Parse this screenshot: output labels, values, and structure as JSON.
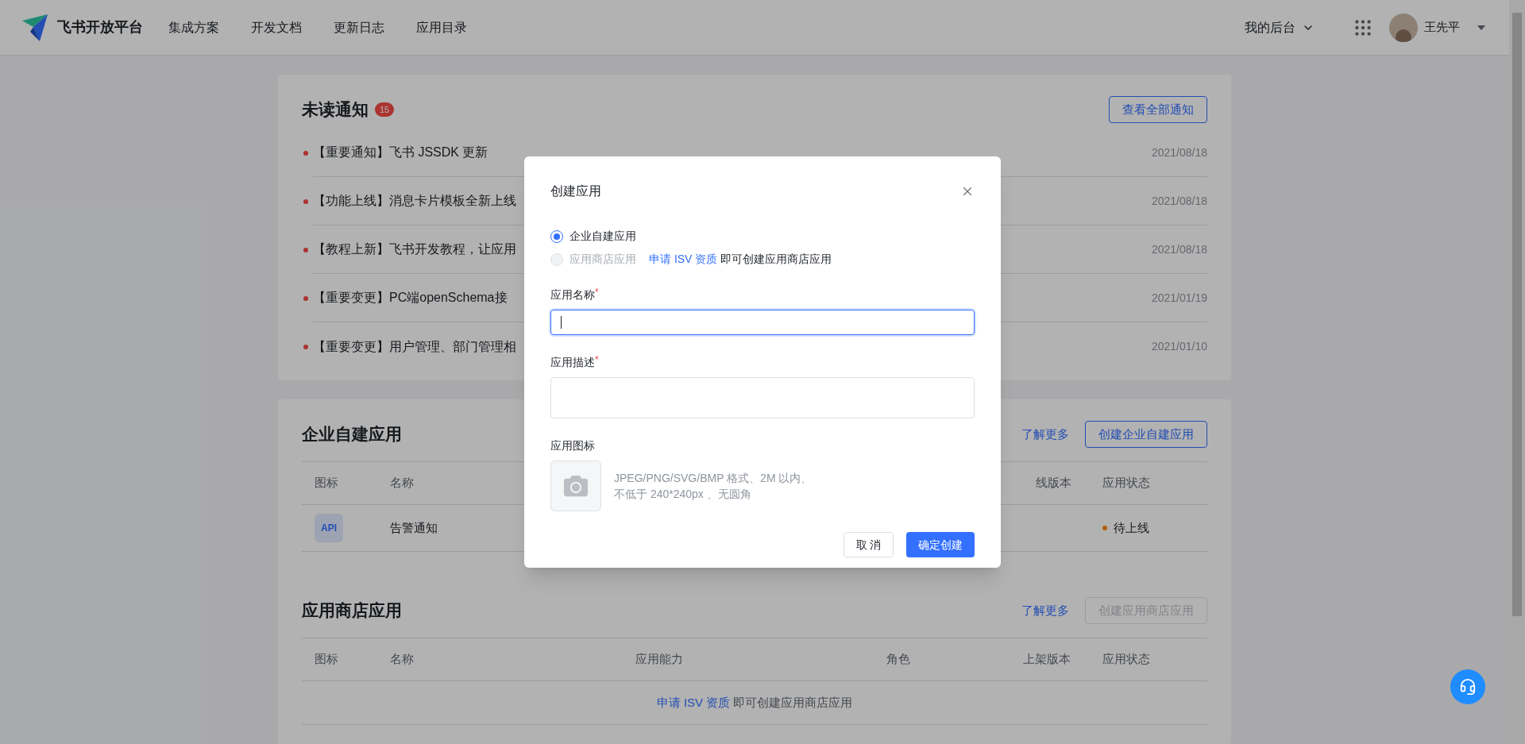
{
  "header": {
    "brand": "飞书开放平台",
    "nav": [
      "集成方案",
      "开发文档",
      "更新日志",
      "应用目录"
    ],
    "workspace_menu": "我的后台",
    "user_name": "王先平"
  },
  "notices": {
    "title": "未读通知",
    "badge": "15",
    "view_all": "查看全部通知",
    "items": [
      {
        "text": "【重要通知】飞书 JSSDK 更新",
        "date": "2021/08/18"
      },
      {
        "text": "【功能上线】消息卡片模板全新上线",
        "date": "2021/08/18"
      },
      {
        "text": "【教程上新】飞书开发教程，让应用",
        "date": "2021/08/18"
      },
      {
        "text": "【重要变更】PC端openSchema接",
        "date": "2021/01/19"
      },
      {
        "text": "【重要变更】用户管理、部门管理相",
        "date": "2021/01/10"
      }
    ]
  },
  "internal_apps": {
    "title": "企业自建应用",
    "learn_more": "了解更多",
    "create_button": {
      "label": "创建企业自建应用",
      "disabled": false
    },
    "columns": [
      "图标",
      "名称",
      "线版本",
      "应用状态"
    ],
    "rows": [
      {
        "icon_text": "API",
        "name": "告警通知",
        "status": "待上线",
        "live": false
      }
    ]
  },
  "store_apps": {
    "title": "应用商店应用",
    "learn_more": "了解更多",
    "create_button": {
      "label": "创建应用商店应用",
      "disabled": true
    },
    "columns": [
      "图标",
      "名称",
      "应用能力",
      "角色",
      "上架版本",
      "应用状态"
    ],
    "empty": {
      "link": "申请 ISV 资质",
      "text": "即可创建应用商店应用"
    }
  },
  "dialog": {
    "title": "创建应用",
    "app_types": [
      {
        "label": "企业自建应用",
        "selected": true,
        "disabled": false
      },
      {
        "label": "应用商店应用",
        "selected": false,
        "disabled": true,
        "link": "申请 ISV 资质",
        "note": "即可创建应用商店应用"
      }
    ],
    "fields": [
      {
        "label": "应用名称",
        "required_mark": "*",
        "kind": "input",
        "focused": true
      },
      {
        "label": "应用描述",
        "required_mark": "*",
        "kind": "textarea",
        "focused": false
      }
    ],
    "icon_field": {
      "label": "应用图标",
      "hint_lines": [
        "JPEG/PNG/SVG/BMP 格式、2M 以内、",
        "不低于 240*240px 、无圆角"
      ]
    },
    "buttons": [
      {
        "label": "取 消",
        "kind": "secondary"
      },
      {
        "label": "确定创建",
        "kind": "primary"
      }
    ]
  }
}
